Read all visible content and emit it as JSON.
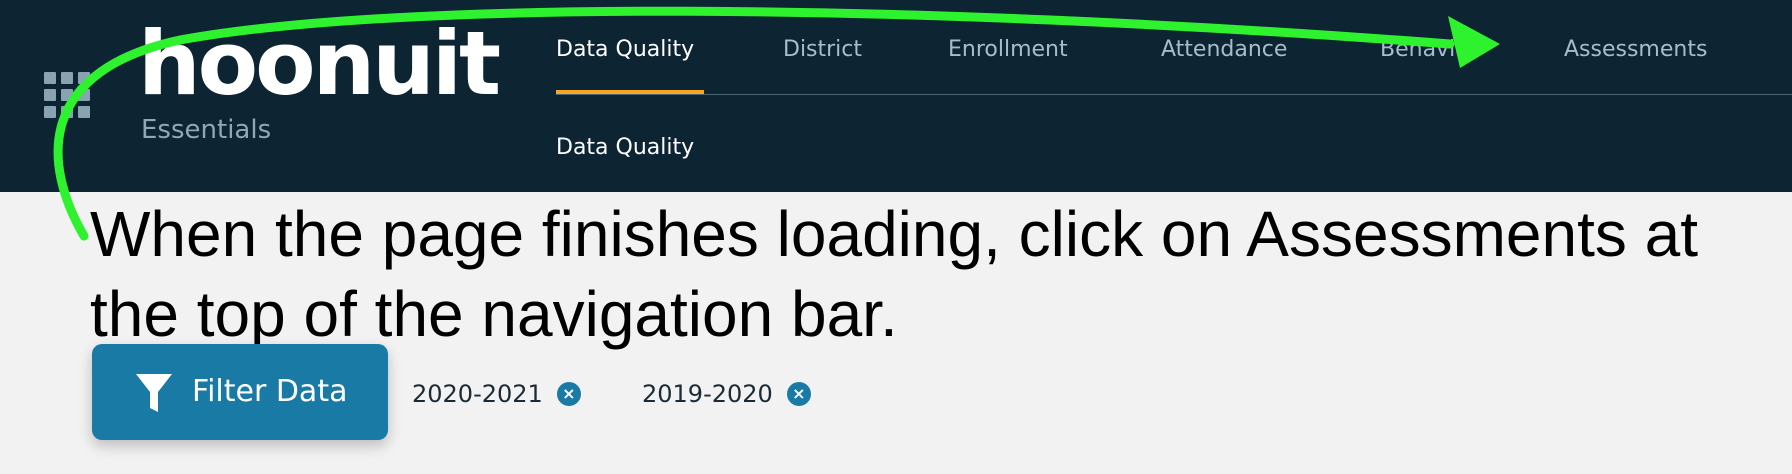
{
  "header": {
    "logo": "hoonuit",
    "logo_subtitle": "Essentials",
    "icons": [
      "apps-grid-icon"
    ],
    "nav": [
      {
        "label": "Data Quality",
        "active": true
      },
      {
        "label": "District",
        "active": false
      },
      {
        "label": "Enrollment",
        "active": false
      },
      {
        "label": "Attendance",
        "active": false
      },
      {
        "label": "Behavior",
        "active": false
      },
      {
        "label": "Assessments",
        "active": false
      }
    ],
    "subnav": [
      "Data Quality"
    ]
  },
  "instruction": {
    "text": "When the page finishes loading, click on Assessments at the top of the navigation bar."
  },
  "filters": {
    "button_label": "Filter Data",
    "button_icon": "filter-icon",
    "chips": [
      {
        "label": "2020-2021",
        "close_icon": "close-icon"
      },
      {
        "label": "2019-2020",
        "close_icon": "close-icon"
      }
    ]
  },
  "overlay": {
    "arrow_icon": "pointer-arrow",
    "arrow_color": "#2ef22e"
  },
  "colors": {
    "header_bg": "#0d2433",
    "accent_underline": "#f5a623",
    "primary": "#1a7aa6",
    "page_bg": "#f2f2f2"
  }
}
